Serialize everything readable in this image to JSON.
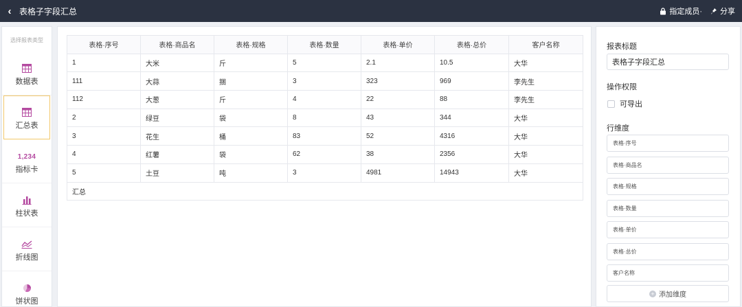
{
  "header": {
    "title": "表格子字段汇总",
    "assign_label": "指定成员·",
    "share_label": "分享"
  },
  "sidebar": {
    "heading": "选择报表类型",
    "items": [
      {
        "label": "数据表",
        "icon": "table-icon"
      },
      {
        "label": "汇总表",
        "icon": "summary-table-icon",
        "active": true
      },
      {
        "label": "指标卡",
        "icon": "metric-card-icon",
        "icon_text": "1,234"
      },
      {
        "label": "柱状表",
        "icon": "bar-chart-icon"
      },
      {
        "label": "折线图",
        "icon": "line-chart-icon"
      },
      {
        "label": "饼状图",
        "icon": "pie-chart-icon"
      }
    ]
  },
  "table": {
    "columns": [
      "表格·序号",
      "表格·商品名",
      "表格·规格",
      "表格·数量",
      "表格·单价",
      "表格·总价",
      "客户名称"
    ],
    "rows": [
      [
        "1",
        "大米",
        "斤",
        "5",
        "2.1",
        "10.5",
        "大华"
      ],
      [
        "111",
        "大蒜",
        "捆",
        "3",
        "323",
        "969",
        "李先生"
      ],
      [
        "112",
        "大葱",
        "斤",
        "4",
        "22",
        "88",
        "李先生"
      ],
      [
        "2",
        "绿豆",
        "袋",
        "8",
        "43",
        "344",
        "大华"
      ],
      [
        "3",
        "花生",
        "桶",
        "83",
        "52",
        "4316",
        "大华"
      ],
      [
        "4",
        "红薯",
        "袋",
        "62",
        "38",
        "2356",
        "大华"
      ],
      [
        "5",
        "土豆",
        "吨",
        "3",
        "4981",
        "14943",
        "大华"
      ]
    ],
    "summary_label": "汇总"
  },
  "panel": {
    "title_label": "报表标题",
    "title_value": "表格子字段汇总",
    "permission_label": "操作权限",
    "exportable_label": "可导出",
    "row_dim_label": "行维度",
    "dimensions": [
      "表格·序号",
      "表格·商品名",
      "表格·规格",
      "表格·数量",
      "表格·单价",
      "表格·总价",
      "客户名称"
    ],
    "add_dim_label": "添加维度"
  },
  "colors": {
    "topbar": "#2b3241",
    "accent_icon": "#b44aa0",
    "active_border": "#f2c86a"
  }
}
